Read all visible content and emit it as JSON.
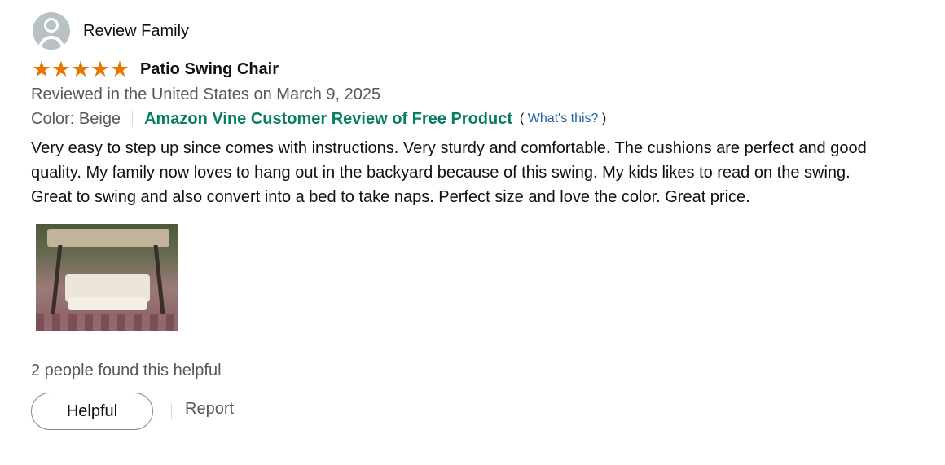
{
  "reviewer": {
    "name": "Review Family",
    "avatar_icon": "default-user-avatar-icon"
  },
  "rating": {
    "stars": 5,
    "max": 5,
    "star_glyph": "★",
    "color": "#e77600"
  },
  "review": {
    "title": "Patio Swing Chair",
    "date": "Reviewed in the United States on March 9, 2025",
    "color_label": "Color: Beige",
    "vine_badge": "Amazon Vine Customer Review of Free Product",
    "whats_this_open": "(",
    "whats_this_link": "What's this?",
    "whats_this_close": ")",
    "body": "Very easy to step up since comes with instructions. Very sturdy and comfortable. The cushions are perfect and good quality. My family now loves to hang out in the backyard because of this swing. My kids likes to read on the swing. Great to swing and also convert into a bed to take naps. Perfect size and love the color. Great price."
  },
  "footer": {
    "helpful_count": "2 people found this helpful",
    "helpful_button": "Helpful",
    "report_link": "Report"
  },
  "colors": {
    "vine_green": "#067d62",
    "link_blue": "#2162a1",
    "secondary_text": "#565959"
  }
}
